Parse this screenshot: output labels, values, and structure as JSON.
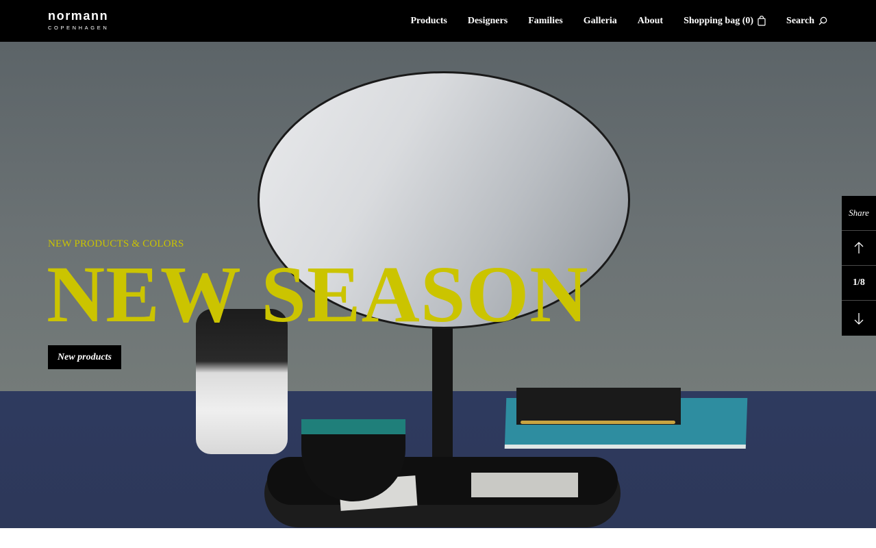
{
  "brand": {
    "name": "normann",
    "sub": "COPENHAGEN"
  },
  "nav": {
    "items": [
      "Products",
      "Designers",
      "Families",
      "Galleria",
      "About"
    ],
    "shopping_bag": "Shopping bag (0)",
    "search": "Search"
  },
  "hero": {
    "kicker": "NEW PRODUCTS & COLORS",
    "headline": "NEW SEASON",
    "cta": "New products"
  },
  "slider": {
    "share": "Share",
    "counter": "1/8"
  },
  "colors": {
    "accent": "#cbc400",
    "bar": "#000000"
  },
  "icons": [
    "shopping-bag-icon",
    "search-icon",
    "arrow-up-icon",
    "arrow-down-icon"
  ]
}
